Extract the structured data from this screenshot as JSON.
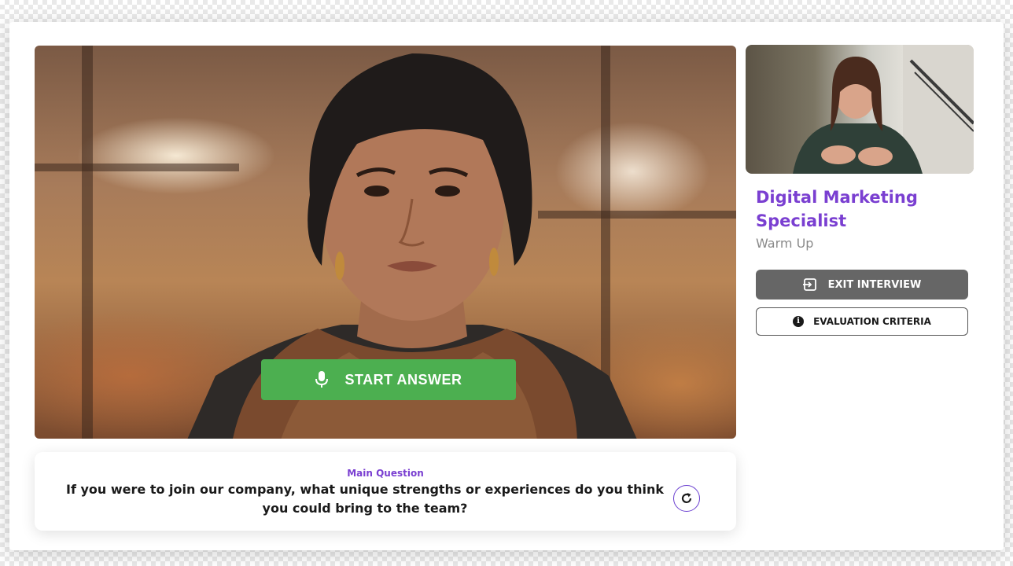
{
  "main_video": {
    "start_answer_label": "START ANSWER"
  },
  "question": {
    "label": "Main Question",
    "text": "If you were to join our company, what unique strengths or experiences do you think you could bring to the team?"
  },
  "side_panel": {
    "role_title": "Digital Marketing Specialist",
    "stage": "Warm Up",
    "exit_label": "EXIT INTERVIEW",
    "criteria_label": "EVALUATION CRITERIA"
  },
  "colors": {
    "accent_purple": "#7a3fd1",
    "start_green": "#4caf50",
    "exit_gray": "#666666"
  },
  "icons": {
    "start_answer": "microphone-icon",
    "refresh": "refresh-icon",
    "exit": "exit-icon",
    "criteria": "info-icon"
  }
}
